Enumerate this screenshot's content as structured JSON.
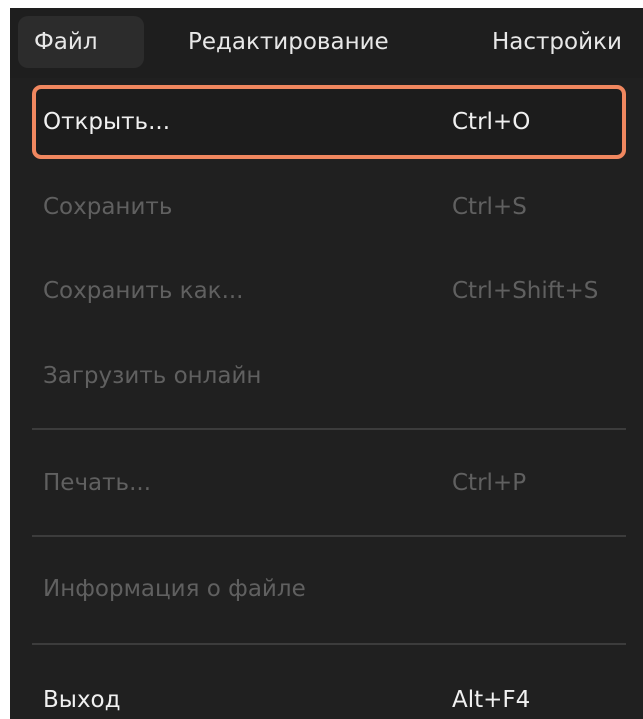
{
  "menubar": {
    "items": [
      {
        "label": "Файл"
      },
      {
        "label": "Редактирование"
      },
      {
        "label": "Настройки"
      }
    ]
  },
  "file_menu": {
    "items": [
      {
        "label": "Открыть...",
        "shortcut": "Ctrl+O",
        "enabled": true,
        "highlighted": true
      },
      {
        "label": "Сохранить",
        "shortcut": "Ctrl+S",
        "enabled": false
      },
      {
        "label": "Сохранить как...",
        "shortcut": "Ctrl+Shift+S",
        "enabled": false
      },
      {
        "label": "Загрузить онлайн",
        "shortcut": "",
        "enabled": false
      },
      {
        "label": "Печать...",
        "shortcut": "Ctrl+P",
        "enabled": false
      },
      {
        "label": "Информация о файле",
        "shortcut": "",
        "enabled": false
      },
      {
        "label": "Выход",
        "shortcut": "Alt+F4",
        "enabled": true
      }
    ]
  },
  "colors": {
    "highlight_border": "#f0875f",
    "menu_background": "#202020",
    "enabled_text": "#f0f0f0",
    "disabled_text": "#606060"
  }
}
